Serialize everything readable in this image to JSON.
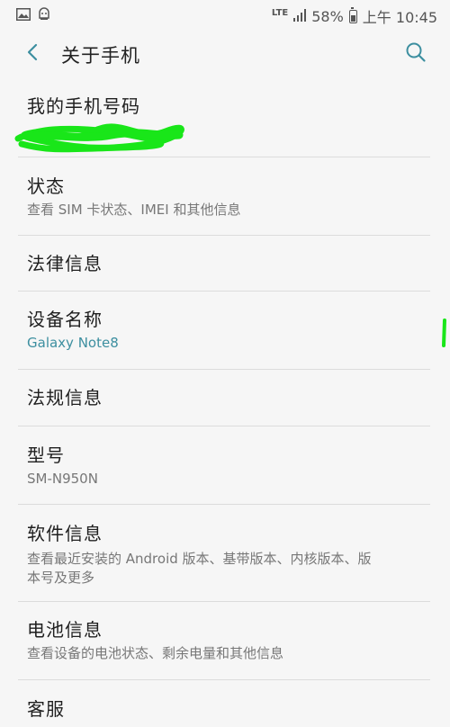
{
  "statusbar": {
    "network": "LTE",
    "battery": "58%",
    "time": "上午 10:45",
    "icons": [
      "gallery-icon",
      "android-icon",
      "signal-icon",
      "battery-icon"
    ]
  },
  "appbar": {
    "title": "关于手机",
    "back_icon": "chevron-left-icon",
    "search_icon": "search-icon"
  },
  "colors": {
    "accent": "#3d8fa0",
    "redaction": "#19e619"
  },
  "items": [
    {
      "title": "我的手机号码",
      "subtitle": ""
    },
    {
      "title": "状态",
      "subtitle": "查看 SIM 卡状态、IMEI 和其他信息"
    },
    {
      "title": "法律信息",
      "subtitle": ""
    },
    {
      "title": "设备名称",
      "subtitle": "Galaxy Note8"
    },
    {
      "title": "法规信息",
      "subtitle": ""
    },
    {
      "title": "型号",
      "subtitle": "SM-N950N"
    },
    {
      "title": "软件信息",
      "subtitle_line1": "查看最近安装的 Android 版本、基带版本、内核版本、版",
      "subtitle_line2": "本号及更多"
    },
    {
      "title": "电池信息",
      "subtitle": "查看设备的电池状态、剩余电量和其他信息"
    },
    {
      "title": "客服",
      "subtitle": ""
    }
  ]
}
